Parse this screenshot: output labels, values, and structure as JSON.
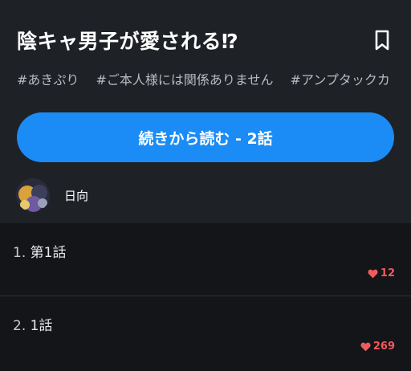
{
  "header": {
    "title": "陰キャ男子が愛される⁉",
    "bookmark_icon": "bookmark-icon"
  },
  "tags": [
    "#あきぷり",
    "#ご本人様には関係ありません",
    "#アンプタックカ"
  ],
  "continue_button": {
    "label": "続きから読む - 2話",
    "color": "#1b8cf5"
  },
  "author": {
    "name": "日向"
  },
  "episodes": [
    {
      "number": "1.",
      "title": "第1話",
      "likes": "12"
    },
    {
      "number": "2.",
      "title": "1話",
      "likes": "269"
    }
  ],
  "colors": {
    "header_bg": "#1e2126",
    "list_bg": "#141519",
    "like": "#ef5b5b"
  }
}
